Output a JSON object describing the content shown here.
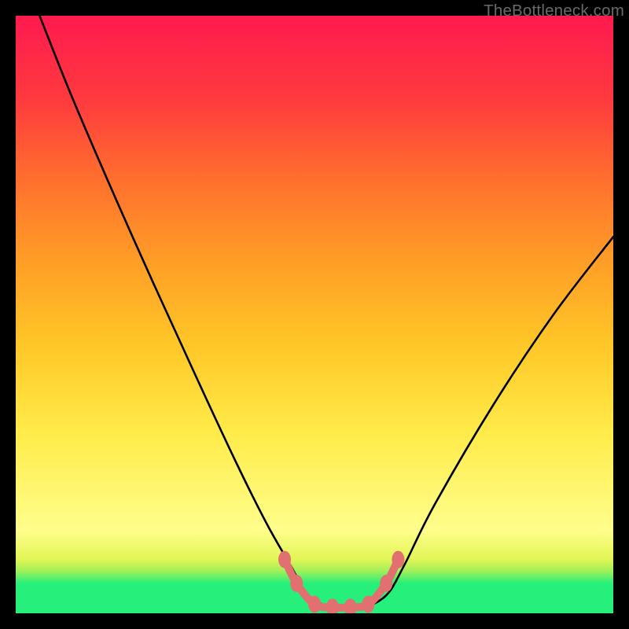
{
  "watermark": "TheBottleneck.com",
  "chart_data": {
    "type": "line",
    "title": "",
    "xlabel": "",
    "ylabel": "",
    "xlim": [
      0,
      100
    ],
    "ylim": [
      0,
      100
    ],
    "series": [
      {
        "name": "curve",
        "x": [
          4,
          10,
          20,
          30,
          37,
          42,
          46,
          49,
          53,
          58,
          62,
          65,
          70,
          80,
          90,
          100
        ],
        "y": [
          100,
          85,
          62,
          40,
          25,
          15,
          8,
          3,
          1,
          1,
          3,
          8,
          18,
          35,
          50,
          63
        ]
      }
    ],
    "markers": {
      "name": "trough-markers",
      "color": "#e27070",
      "points": [
        {
          "x": 45,
          "y": 9
        },
        {
          "x": 47,
          "y": 5
        },
        {
          "x": 50,
          "y": 1.5
        },
        {
          "x": 53,
          "y": 1
        },
        {
          "x": 56,
          "y": 1
        },
        {
          "x": 59,
          "y": 1.5
        },
        {
          "x": 62,
          "y": 5
        },
        {
          "x": 64,
          "y": 9
        }
      ]
    },
    "gradient_stops": [
      {
        "pos": 0,
        "color": "#26ef7b"
      },
      {
        "pos": 5,
        "color": "#26ef7b"
      },
      {
        "pos": 7,
        "color": "#9df05a"
      },
      {
        "pos": 9,
        "color": "#e2f556"
      },
      {
        "pos": 14,
        "color": "#fffe8c"
      },
      {
        "pos": 30,
        "color": "#ffec4a"
      },
      {
        "pos": 45,
        "color": "#ffc727"
      },
      {
        "pos": 60,
        "color": "#ff9a27"
      },
      {
        "pos": 74,
        "color": "#ff6a2f"
      },
      {
        "pos": 86,
        "color": "#ff3a3f"
      },
      {
        "pos": 100,
        "color": "#ff1a4f"
      }
    ]
  }
}
